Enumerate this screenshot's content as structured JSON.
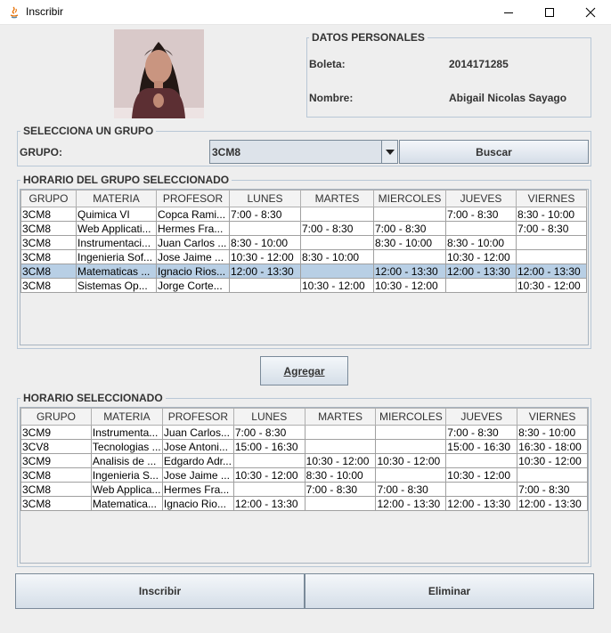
{
  "window": {
    "title": "Inscribir",
    "controls": [
      "minimize-icon",
      "maximize-icon",
      "close-icon"
    ]
  },
  "personal": {
    "section_title": "DATOS PERSONALES",
    "boleta_label": "Boleta:",
    "boleta_value": "2014171285",
    "nombre_label": "Nombre:",
    "nombre_value": "Abigail Nicolas Sayago"
  },
  "group_select": {
    "section_title": "SELECCIONA UN GRUPO",
    "label": "GRUPO:",
    "selected": "3CM8",
    "search_button": "Buscar"
  },
  "group_schedule": {
    "section_title": "HORARIO DEL GRUPO SELECCIONADO",
    "columns": [
      "GRUPO",
      "MATERIA",
      "PROFESOR",
      "LUNES",
      "MARTES",
      "MIERCOLES",
      "JUEVES",
      "VIERNES"
    ],
    "selected_row": 4,
    "rows": [
      [
        "3CM8",
        "Quimica VI",
        "Copca Rami...",
        "7:00 - 8:30",
        "",
        "",
        "7:00 - 8:30",
        "8:30 - 10:00"
      ],
      [
        "3CM8",
        "Web Applicati...",
        "Hermes Fra...",
        "",
        "7:00 - 8:30",
        "7:00 - 8:30",
        "",
        "7:00 - 8:30"
      ],
      [
        "3CM8",
        "Instrumentaci...",
        "Juan Carlos ...",
        "8:30 - 10:00",
        "",
        "8:30 - 10:00",
        "8:30 - 10:00",
        ""
      ],
      [
        "3CM8",
        "Ingenieria Sof...",
        "Jose Jaime ...",
        "10:30 - 12:00",
        "8:30 - 10:00",
        "",
        "10:30 - 12:00",
        ""
      ],
      [
        "3CM8",
        "Matematicas ...",
        "Ignacio Rios...",
        "12:00 - 13:30",
        "",
        "12:00 - 13:30",
        "12:00 - 13:30",
        "12:00 - 13:30"
      ],
      [
        "3CM8",
        "Sistemas Op...",
        "Jorge Corte...",
        "",
        "10:30 - 12:00",
        "10:30 - 12:00",
        "",
        "10:30 - 12:00"
      ]
    ]
  },
  "add_button": "Agregar",
  "selected_schedule": {
    "section_title": "HORARIO SELECCIONADO",
    "columns": [
      "GRUPO",
      "MATERIA",
      "PROFESOR",
      "LUNES",
      "MARTES",
      "MIERCOLES",
      "JUEVES",
      "VIERNES"
    ],
    "rows": [
      [
        "3CM9",
        "Instrumenta...",
        "Juan Carlos...",
        "7:00 - 8:30",
        "",
        "",
        "7:00 - 8:30",
        "8:30 - 10:00"
      ],
      [
        "3CV8",
        "Tecnologias ...",
        "Jose Antoni...",
        "15:00 - 16:30",
        "",
        "",
        "15:00 - 16:30",
        "16:30 - 18:00"
      ],
      [
        "3CM9",
        "Analisis de ...",
        "Edgardo Adr...",
        "",
        "10:30 - 12:00",
        "10:30 - 12:00",
        "",
        "10:30 - 12:00"
      ],
      [
        "3CM8",
        "Ingenieria S...",
        "Jose Jaime ...",
        "10:30 - 12:00",
        "8:30 - 10:00",
        "",
        "10:30 - 12:00",
        ""
      ],
      [
        "3CM8",
        "Web Applica...",
        "Hermes Fra...",
        "",
        "7:00 - 8:30",
        "7:00 - 8:30",
        "",
        "7:00 - 8:30"
      ],
      [
        "3CM8",
        "Matematica...",
        "Ignacio Rio...",
        "12:00 - 13:30",
        "",
        "12:00 - 13:30",
        "12:00 - 13:30",
        "12:00 - 13:30"
      ]
    ]
  },
  "footer": {
    "enroll_button": "Inscribir",
    "delete_button": "Eliminar"
  }
}
